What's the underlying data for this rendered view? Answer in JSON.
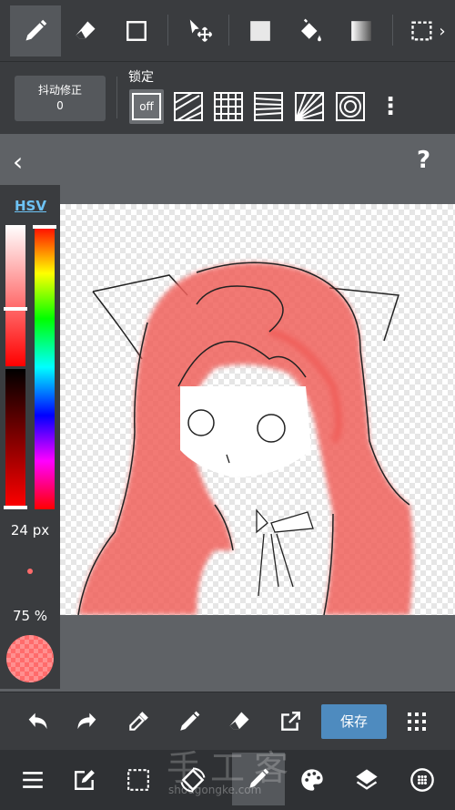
{
  "top_toolbar": {
    "tools": [
      "pen-icon",
      "eraser-icon",
      "rectangle-icon",
      "move-icon",
      "fill-square-icon",
      "bucket-icon",
      "gradient-icon",
      "selection-icon"
    ]
  },
  "sub_toolbar": {
    "stabilizer_label": "抖动修正",
    "stabilizer_value": "0",
    "lock_label": "锁定",
    "lock_off_label": "off"
  },
  "color_panel": {
    "mode_label": "HSV",
    "brush_size": "24 px",
    "opacity": "75 %",
    "brush_color": "#ff6b6b"
  },
  "bottom_toolbar": {
    "save_label": "保存"
  },
  "watermark": {
    "cn": "手工客",
    "en": "shougongke.com"
  },
  "colors": {
    "accent": "#4e8bbf",
    "hair": "#f0605c",
    "toolbar": "#3a3c3f"
  }
}
